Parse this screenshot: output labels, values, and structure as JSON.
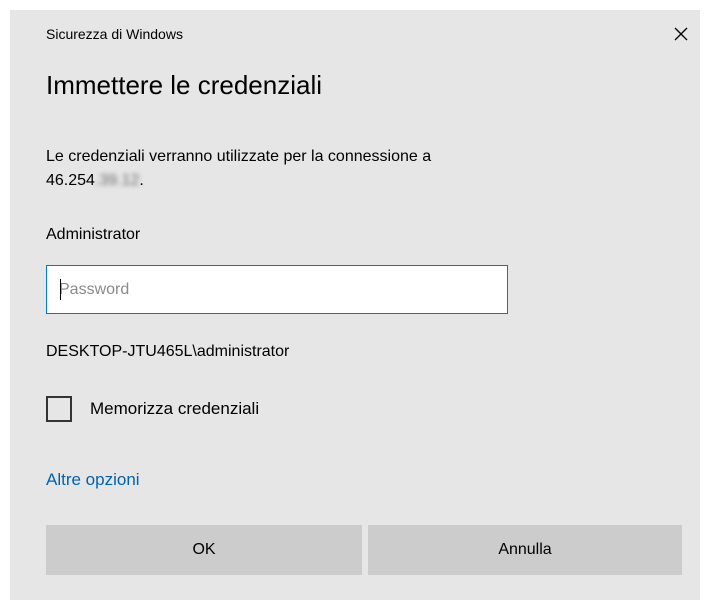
{
  "dialog": {
    "window_title": "Sicurezza di Windows",
    "heading": "Immettere le credenziali",
    "message_prefix": "Le credenziali verranno utilizzate per la connessione a",
    "ip_visible": "46.254",
    "ip_blurred": ".39.12",
    "ip_suffix": ".",
    "username": "Administrator",
    "password": {
      "placeholder": "Password",
      "value": ""
    },
    "domain_user": "DESKTOP-JTU465L\\administrator",
    "remember_label": "Memorizza credenziali",
    "remember_checked": false,
    "more_options": "Altre opzioni",
    "ok_label": "OK",
    "cancel_label": "Annulla"
  },
  "colors": {
    "dialog_bg": "#e6e6e6",
    "accent": "#0078d7",
    "link": "#0063b1",
    "button_bg": "#cccccc"
  },
  "icons": {
    "close": "close-icon"
  }
}
